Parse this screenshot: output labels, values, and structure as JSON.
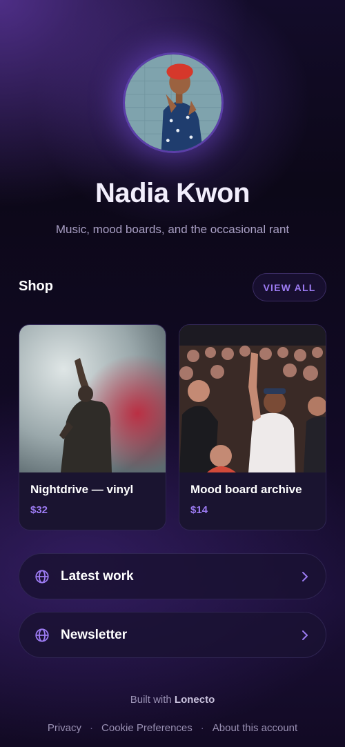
{
  "profile": {
    "name": "Nadia Kwon",
    "bio": "Music, mood boards, and the occasional rant"
  },
  "shop": {
    "title": "Shop",
    "view_all_label": "VIEW ALL",
    "items": [
      {
        "title": "Nightdrive — vinyl",
        "price": "$32"
      },
      {
        "title": "Mood board archive",
        "price": "$14"
      }
    ]
  },
  "links": [
    {
      "label": "Latest work",
      "icon": "globe-icon"
    },
    {
      "label": "Newsletter",
      "icon": "globe-icon"
    }
  ],
  "footer": {
    "built_prefix": "Built with",
    "built_brand": "Lonecto",
    "links": [
      "Privacy",
      "Cookie Preferences",
      "About this account"
    ],
    "separator": "·"
  },
  "colors": {
    "accent": "#9c7bf2",
    "background": "#0c0818",
    "card": "#1a1430"
  }
}
